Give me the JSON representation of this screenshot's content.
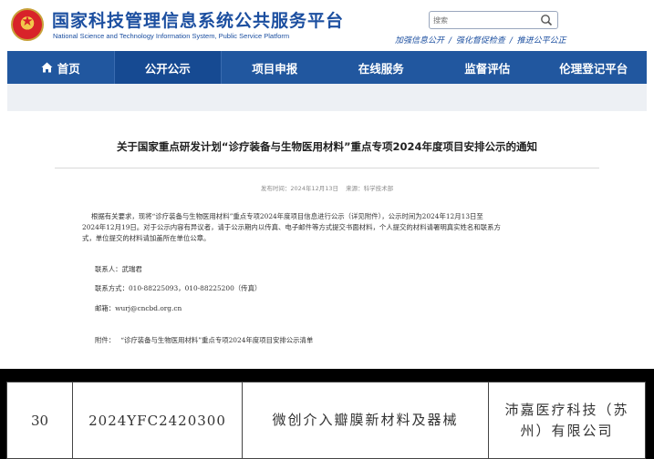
{
  "header": {
    "site_title": "国家科技管理信息系统公共服务平台",
    "site_subtitle": "National Science and Technology Information System, Public Service Platform",
    "search": {
      "placeholder": "搜索"
    },
    "slogans": [
      "加强信息公开",
      "强化督促检查",
      "推进公平公正"
    ]
  },
  "nav": {
    "items": [
      "首页",
      "公开公示",
      "项目申报",
      "在线服务",
      "监督评估",
      "伦理登记平台"
    ],
    "active": "公开公示"
  },
  "article": {
    "title": "关于国家重点研发计划“诊疗装备与生物医用材料”重点专项2024年度项目安排公示的通知",
    "publish_time": "发布时间：2024年12月13日",
    "source": "来源：科学技术部",
    "paragraph_lines": [
      "根据有关要求，现将“诊疗装备与生物医用材料”重点专项2024年度项目信息进行公示（详见附件），公示时间为2024年12月13日至",
      "2024年12月19日。对于公示内容有异议者，请于公示期内以传真、电子邮件等方式提交书面材料，个人提交的材料请署明真实姓名和联系方",
      "式，单位提交的材料请加盖所在单位公章。"
    ],
    "contact_name": "联系人：武瑞君",
    "contact_phone": "联系方式：010-88225093，010-88225200（传真）",
    "contact_email": "邮箱：wurj@cncbd.org.cn",
    "attachment_label": "附件：",
    "attachment_link": "“诊疗装备与生物医用材料”重点专项2024年度项目安排公示清单"
  },
  "table": {
    "rows": [
      {
        "no": "30",
        "code": "2024YFC2420300",
        "project_name": "微创介入瓣膜新材料及器械",
        "unit": "沛嘉医疗科技（苏州）有限公司"
      }
    ]
  },
  "colors": {
    "brand_blue": "#1c4fa0",
    "nav_bg": "#21579f",
    "nav_active": "#164a92",
    "emblem_red": "#d8232a",
    "emblem_gold": "#f2c84b"
  },
  "icons": [
    "national-emblem-icon",
    "search-icon",
    "home-icon"
  ]
}
